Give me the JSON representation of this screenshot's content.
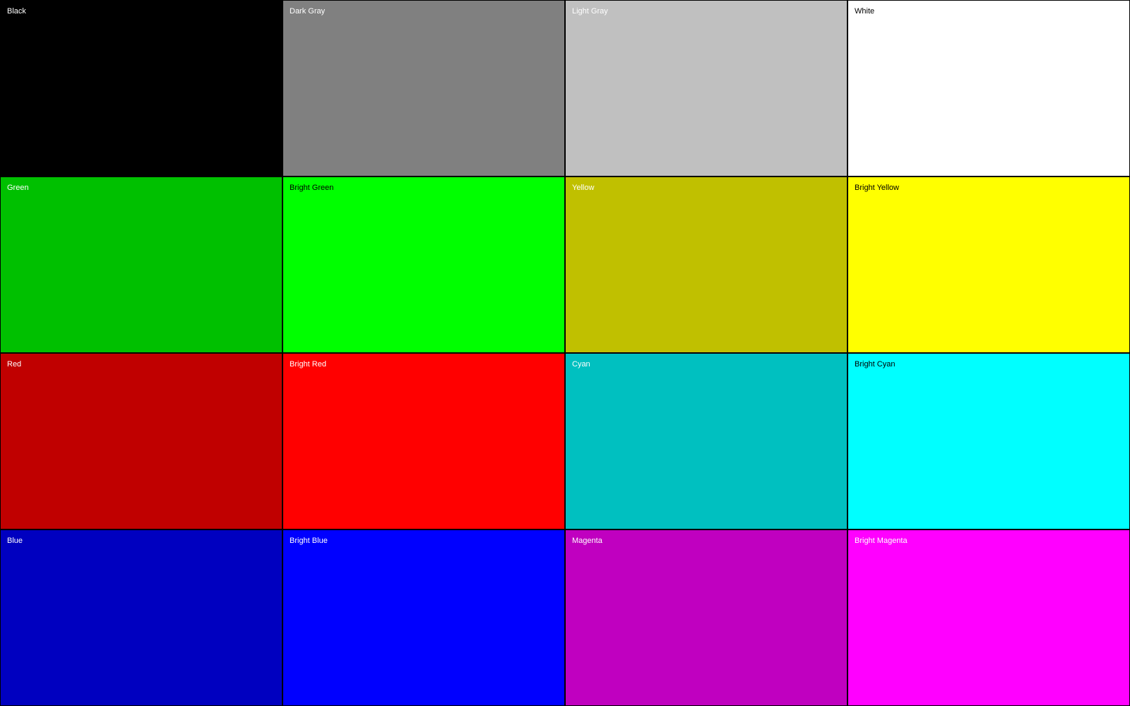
{
  "swatches": [
    {
      "label": "Black",
      "color": "#000000",
      "text_color": "#ffffff"
    },
    {
      "label": "Dark Gray",
      "color": "#808080",
      "text_color": "#ffffff"
    },
    {
      "label": "Light Gray",
      "color": "#c0c0c0",
      "text_color": "#ffffff"
    },
    {
      "label": "White",
      "color": "#ffffff",
      "text_color": "#000000"
    },
    {
      "label": "Green",
      "color": "#00c000",
      "text_color": "#ffffff"
    },
    {
      "label": "Bright Green",
      "color": "#00ff00",
      "text_color": "#000000"
    },
    {
      "label": "Yellow",
      "color": "#c0c000",
      "text_color": "#ffffff"
    },
    {
      "label": "Bright Yellow",
      "color": "#ffff00",
      "text_color": "#000000"
    },
    {
      "label": "Red",
      "color": "#c00000",
      "text_color": "#ffffff"
    },
    {
      "label": "Bright Red",
      "color": "#ff0000",
      "text_color": "#ffffff"
    },
    {
      "label": "Cyan",
      "color": "#00c0c0",
      "text_color": "#ffffff"
    },
    {
      "label": "Bright Cyan",
      "color": "#00ffff",
      "text_color": "#000000"
    },
    {
      "label": "Blue",
      "color": "#0000c0",
      "text_color": "#ffffff"
    },
    {
      "label": "Bright Blue",
      "color": "#0000ff",
      "text_color": "#ffffff"
    },
    {
      "label": "Magenta",
      "color": "#c000c0",
      "text_color": "#ffffff"
    },
    {
      "label": "Bright Magenta",
      "color": "#ff00ff",
      "text_color": "#ffffff"
    }
  ]
}
